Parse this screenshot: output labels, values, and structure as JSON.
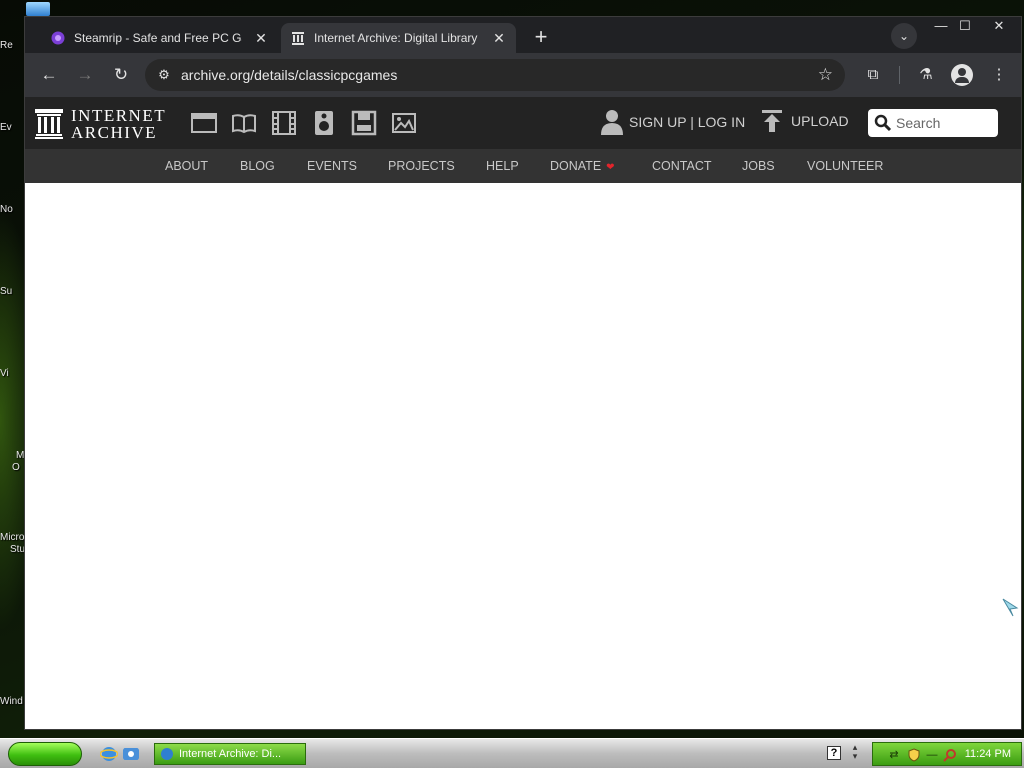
{
  "desktop": {
    "labels": [
      "Re",
      "Ev",
      "No",
      "Su",
      "Vi",
      "M",
      "O",
      "Micro",
      "Stu",
      "Wind"
    ]
  },
  "browser": {
    "tabs": [
      {
        "title": "Steamrip - Safe and Free PC Games",
        "favicon": "steamrip-favicon",
        "active": false
      },
      {
        "title": "Internet Archive: Digital Library of",
        "favicon": "internet-archive-favicon",
        "active": true
      }
    ],
    "new_tab_glyph": "+",
    "tab_search_glyph": "⌄",
    "window_controls": {
      "minimize": "—",
      "maximize": "☐",
      "close": "✕"
    },
    "toolbar": {
      "back": "←",
      "forward": "→",
      "reload": "↻",
      "site_info": "⚙",
      "url": "archive.org/details/classicpcgames",
      "bookmark": "☆",
      "extensions": "⧉",
      "labs": "⚗",
      "menu": "⋮"
    }
  },
  "archive": {
    "logo_line1": "INTERNET",
    "logo_line2": "ARCHIVE",
    "media_icons": [
      "web-icon",
      "texts-icon",
      "video-icon",
      "audio-icon",
      "software-icon",
      "images-icon"
    ],
    "account_label": "SIGN UP | LOG IN",
    "upload_label": "UPLOAD",
    "search_placeholder": "Search",
    "nav": [
      {
        "label": "ABOUT"
      },
      {
        "label": "BLOG"
      },
      {
        "label": "EVENTS"
      },
      {
        "label": "PROJECTS"
      },
      {
        "label": "HELP"
      },
      {
        "label": "DONATE",
        "heart": "❤"
      },
      {
        "label": "CONTACT"
      },
      {
        "label": "JOBS"
      },
      {
        "label": "VOLUNTEER"
      }
    ]
  },
  "taskbar": {
    "task_label": "Internet Archive: Di...",
    "help_glyph": "?",
    "clock": "11:24 PM"
  },
  "colors": {
    "chrome_dark": "#202124",
    "chrome_toolbar": "#35363a",
    "ia_header": "#232323",
    "ia_nav": "#333333",
    "donate_heart": "#e3242b",
    "xp_green": "#3fbf10"
  }
}
